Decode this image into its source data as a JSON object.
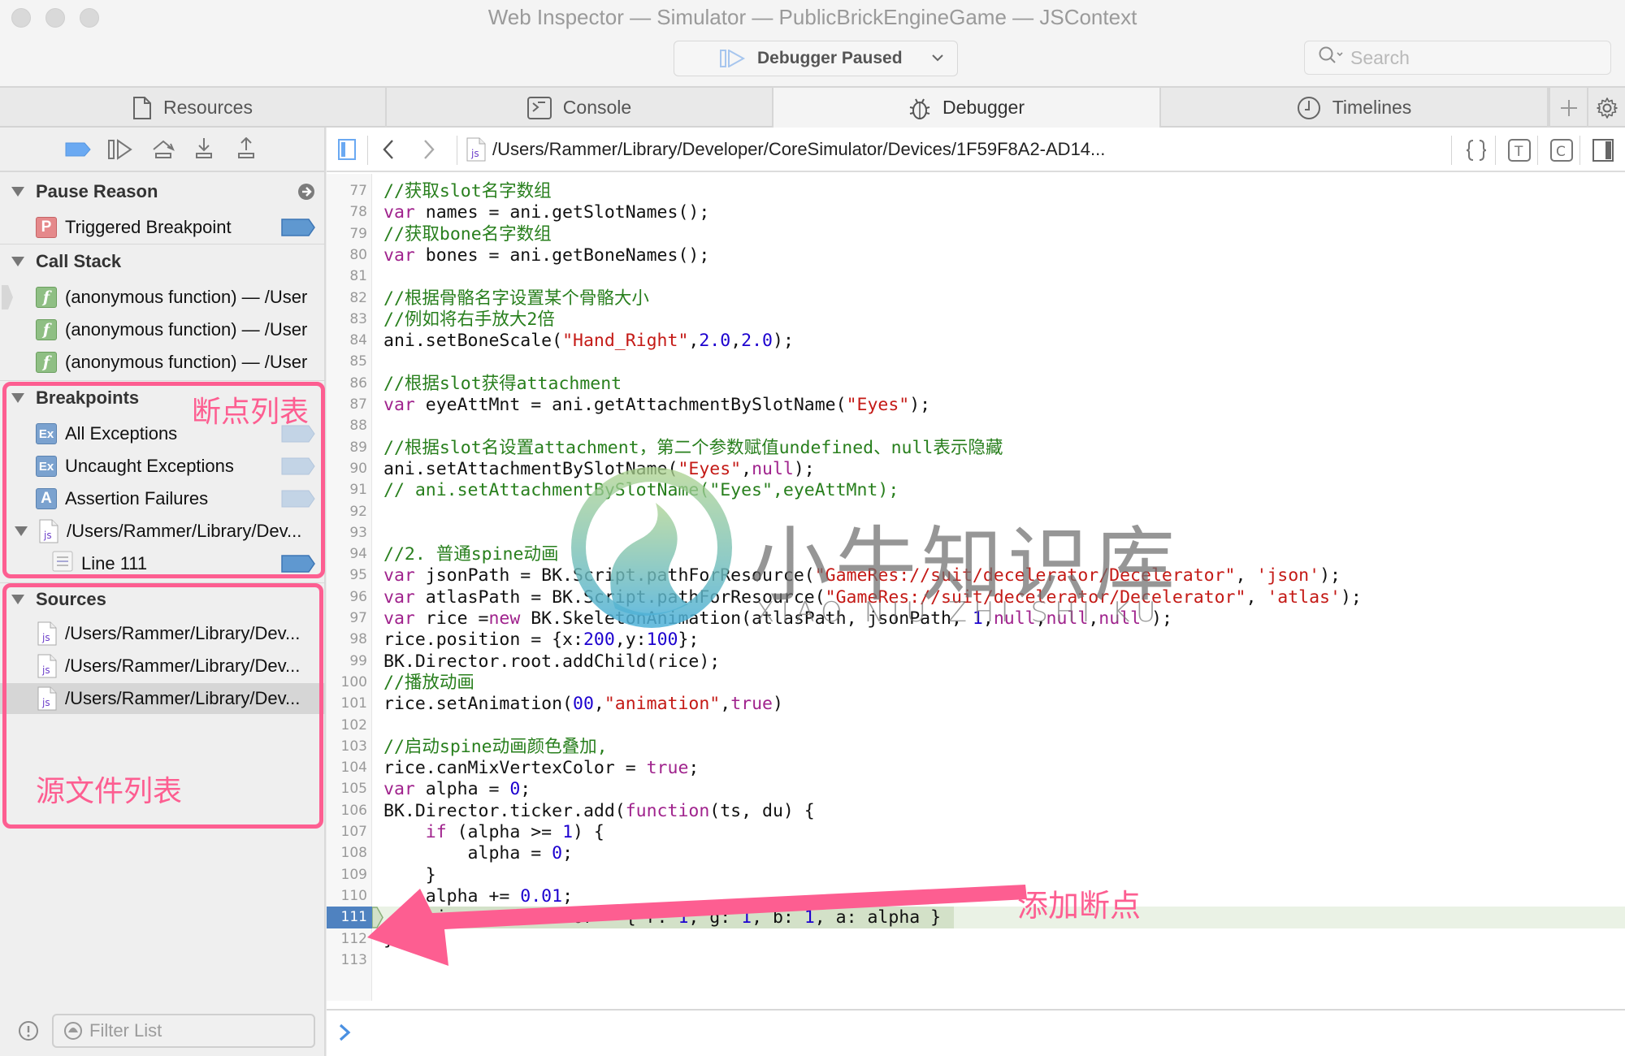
{
  "window": {
    "title": "Web Inspector — Simulator — PublicBrickEngineGame — JSContext",
    "status": "Debugger Paused",
    "search_placeholder": "Search"
  },
  "tabs": [
    {
      "label": "Resources",
      "icon": "document-icon",
      "active": false
    },
    {
      "label": "Console",
      "icon": "console-icon",
      "active": false
    },
    {
      "label": "Debugger",
      "icon": "bug-icon",
      "active": true
    },
    {
      "label": "Timelines",
      "icon": "clock-icon",
      "active": false
    }
  ],
  "sidebar": {
    "pause_reason": {
      "title": "Pause Reason",
      "item": {
        "label": "Triggered Breakpoint",
        "badge": "P"
      }
    },
    "call_stack": {
      "title": "Call Stack",
      "frames": [
        {
          "label": "(anonymous function) — /User"
        },
        {
          "label": "(anonymous function) — /User"
        },
        {
          "label": "(anonymous function) — /User"
        }
      ]
    },
    "breakpoints": {
      "title": "Breakpoints",
      "items": [
        {
          "label": "All Exceptions",
          "badge": "Ex"
        },
        {
          "label": "Uncaught Exceptions",
          "badge": "Ex"
        },
        {
          "label": "Assertion Failures",
          "badge": "A"
        }
      ],
      "file": {
        "label": "/Users/Rammer/Library/Dev..."
      },
      "line": {
        "label": "Line 111"
      }
    },
    "sources": {
      "title": "Sources",
      "files": [
        {
          "label": "/Users/Rammer/Library/Dev..."
        },
        {
          "label": "/Users/Rammer/Library/Dev..."
        },
        {
          "label": "/Users/Rammer/Library/Dev...",
          "selected": true
        }
      ]
    },
    "filter_placeholder": "Filter List"
  },
  "navbar": {
    "path": "/Users/Rammer/Library/Developer/CoreSimulator/Devices/1F59F8A2-AD14..."
  },
  "annotations": {
    "breakpoints_label": "断点列表",
    "sources_label": "源文件列表",
    "add_breakpoint_label": "添加断点"
  },
  "watermark": {
    "cn": "小牛知识库",
    "en": "XIAO NIU ZHI SHI KU"
  },
  "editor": {
    "current_line": 111,
    "lines": [
      {
        "n": "77",
        "tokens": [
          [
            "cmt",
            "//获取slot名字数组"
          ]
        ]
      },
      {
        "n": "78",
        "tokens": [
          [
            "kw",
            "var"
          ],
          [
            "",
            " names = ani.getSlotNames();"
          ]
        ]
      },
      {
        "n": "79",
        "tokens": [
          [
            "cmt",
            "//获取bone名字数组"
          ]
        ]
      },
      {
        "n": "80",
        "tokens": [
          [
            "kw",
            "var"
          ],
          [
            "",
            " bones = ani.getBoneNames();"
          ]
        ]
      },
      {
        "n": "81",
        "tokens": []
      },
      {
        "n": "82",
        "tokens": [
          [
            "cmt",
            "//根据骨骼名字设置某个骨骼大小"
          ]
        ]
      },
      {
        "n": "83",
        "tokens": [
          [
            "cmt",
            "//例如将右手放大2倍"
          ]
        ]
      },
      {
        "n": "84",
        "tokens": [
          [
            "",
            "ani.setBoneScale("
          ],
          [
            "str",
            "\"Hand_Right\""
          ],
          [
            "",
            ","
          ],
          [
            "num",
            "2.0"
          ],
          [
            "",
            ","
          ],
          [
            "num",
            "2.0"
          ],
          [
            "",
            ");"
          ]
        ]
      },
      {
        "n": "85",
        "tokens": []
      },
      {
        "n": "86",
        "tokens": [
          [
            "cmt",
            "//根据slot获得attachment"
          ]
        ]
      },
      {
        "n": "87",
        "tokens": [
          [
            "kw",
            "var"
          ],
          [
            "",
            " eyeAttMnt = ani.getAttachmentBySlotName("
          ],
          [
            "str",
            "\"Eyes\""
          ],
          [
            "",
            ");"
          ]
        ]
      },
      {
        "n": "88",
        "tokens": []
      },
      {
        "n": "89",
        "tokens": [
          [
            "cmt",
            "//根据slot名设置attachment，第二个参数赋值undefined、null表示隐藏"
          ]
        ]
      },
      {
        "n": "90",
        "tokens": [
          [
            "",
            "ani.setAttachmentBySlotName("
          ],
          [
            "str",
            "\"Eyes\""
          ],
          [
            "",
            ","
          ],
          [
            "kw",
            "null"
          ],
          [
            "",
            ");"
          ]
        ]
      },
      {
        "n": "91",
        "tokens": [
          [
            "cmt",
            "// ani.setAttachmentBySlotName(\"Eyes\",eyeAttMnt);"
          ]
        ]
      },
      {
        "n": "92",
        "tokens": []
      },
      {
        "n": "93",
        "tokens": []
      },
      {
        "n": "94",
        "tokens": [
          [
            "cmt",
            "//2. 普通spine动画"
          ]
        ]
      },
      {
        "n": "95",
        "tokens": [
          [
            "kw",
            "var"
          ],
          [
            "",
            " jsonPath = BK.Script.pathForResource("
          ],
          [
            "str",
            "\"GameRes://suit/decelerator/Decelerator\""
          ],
          [
            "",
            ", "
          ],
          [
            "str",
            "'json'"
          ],
          [
            "",
            ");"
          ]
        ]
      },
      {
        "n": "96",
        "tokens": [
          [
            "kw",
            "var"
          ],
          [
            "",
            " atlasPath = BK.Script.pathForResource("
          ],
          [
            "str",
            "\"GameRes://suit/decelerator/Decelerator\""
          ],
          [
            "",
            ", "
          ],
          [
            "str",
            "'atlas'"
          ],
          [
            "",
            ");"
          ]
        ]
      },
      {
        "n": "97",
        "tokens": [
          [
            "kw",
            "var"
          ],
          [
            "",
            " rice ="
          ],
          [
            "kw",
            "new"
          ],
          [
            "",
            " BK.SkeletonAnimation(atlasPath, jsonPath, "
          ],
          [
            "num",
            "1"
          ],
          [
            "",
            ","
          ],
          [
            "kw",
            "null"
          ],
          [
            "",
            ","
          ],
          [
            "kw",
            "null"
          ],
          [
            "",
            ","
          ],
          [
            "kw",
            "null"
          ],
          [
            "",
            " );"
          ]
        ]
      },
      {
        "n": "98",
        "tokens": [
          [
            "",
            "rice.position = {x:"
          ],
          [
            "num",
            "200"
          ],
          [
            "",
            ",y:"
          ],
          [
            "num",
            "100"
          ],
          [
            "",
            "};"
          ]
        ]
      },
      {
        "n": "99",
        "tokens": [
          [
            "",
            "BK.Director.root.addChild(rice);"
          ]
        ]
      },
      {
        "n": "100",
        "tokens": [
          [
            "cmt",
            "//播放动画"
          ]
        ]
      },
      {
        "n": "101",
        "tokens": [
          [
            "",
            "rice.setAnimation("
          ],
          [
            "num",
            "00"
          ],
          [
            "",
            ","
          ],
          [
            "str",
            "\"animation\""
          ],
          [
            "",
            ","
          ],
          [
            "kw",
            "true"
          ],
          [
            "",
            ")"
          ]
        ]
      },
      {
        "n": "102",
        "tokens": []
      },
      {
        "n": "103",
        "tokens": [
          [
            "cmt",
            "//启动spine动画颜色叠加,"
          ]
        ]
      },
      {
        "n": "104",
        "tokens": [
          [
            "",
            "rice.canMixVertexColor = "
          ],
          [
            "kw",
            "true"
          ],
          [
            "",
            ";"
          ]
        ]
      },
      {
        "n": "105",
        "tokens": [
          [
            "kw",
            "var"
          ],
          [
            "",
            " alpha = "
          ],
          [
            "num",
            "0"
          ],
          [
            "",
            ";"
          ]
        ]
      },
      {
        "n": "106",
        "tokens": [
          [
            "",
            "BK.Director.ticker.add("
          ],
          [
            "kw",
            "function"
          ],
          [
            "",
            "(ts, du) {"
          ]
        ]
      },
      {
        "n": "107",
        "tokens": [
          [
            "",
            "    "
          ],
          [
            "kw",
            "if"
          ],
          [
            "",
            " (alpha >= "
          ],
          [
            "num",
            "1"
          ],
          [
            "",
            ") {"
          ]
        ]
      },
      {
        "n": "108",
        "tokens": [
          [
            "",
            "        alpha = "
          ],
          [
            "num",
            "0"
          ],
          [
            "",
            ";"
          ]
        ]
      },
      {
        "n": "109",
        "tokens": [
          [
            "",
            "    }"
          ]
        ]
      },
      {
        "n": "110",
        "tokens": [
          [
            "",
            "    alpha += "
          ],
          [
            "num",
            "0.01"
          ],
          [
            "",
            ";"
          ]
        ]
      },
      {
        "n": "111",
        "tokens": [
          [
            "",
            "    rice.vertexColor = { r: "
          ],
          [
            "num",
            "1"
          ],
          [
            "",
            ", g: "
          ],
          [
            "num",
            "1"
          ],
          [
            "",
            ", b: "
          ],
          [
            "num",
            "1"
          ],
          [
            "",
            ", a: alpha }"
          ]
        ]
      },
      {
        "n": "112",
        "tokens": [
          [
            "",
            "})"
          ]
        ]
      },
      {
        "n": "113",
        "tokens": []
      }
    ]
  },
  "colors": {
    "accent": "#4f82c0",
    "annotation": "#fd5e91",
    "comment": "#287f1d",
    "keyword": "#a0238d",
    "string": "#c41a16",
    "number": "#1c00cf"
  }
}
